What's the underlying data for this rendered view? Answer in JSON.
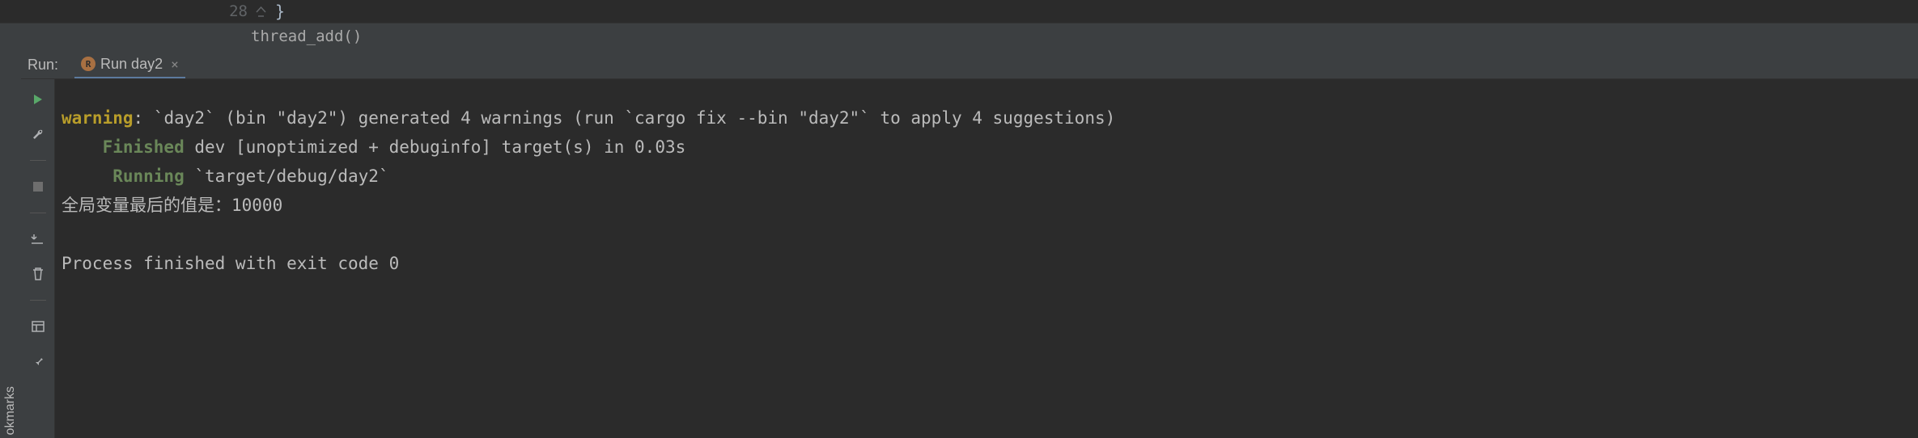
{
  "editor": {
    "line_number": "28",
    "code": "}"
  },
  "breadcrumb": {
    "item": "thread_add()"
  },
  "run_panel": {
    "label": "Run:",
    "tab_title": "Run day2"
  },
  "vertical_tab": {
    "label": "okmarks"
  },
  "console": {
    "line1_warn": "warning",
    "line1_rest": ": `day2` (bin \"day2\") generated 4 warnings (run `cargo fix --bin \"day2\"` to apply 4 suggestions)",
    "line2_green": "Finished",
    "line2_rest": " dev [unoptimized + debuginfo] target(s) in 0.03s",
    "line3_green": "Running",
    "line3_rest": " `target/debug/day2`",
    "line4": "全局变量最后的值是：10000",
    "line5": "",
    "line6": "Process finished with exit code 0"
  }
}
